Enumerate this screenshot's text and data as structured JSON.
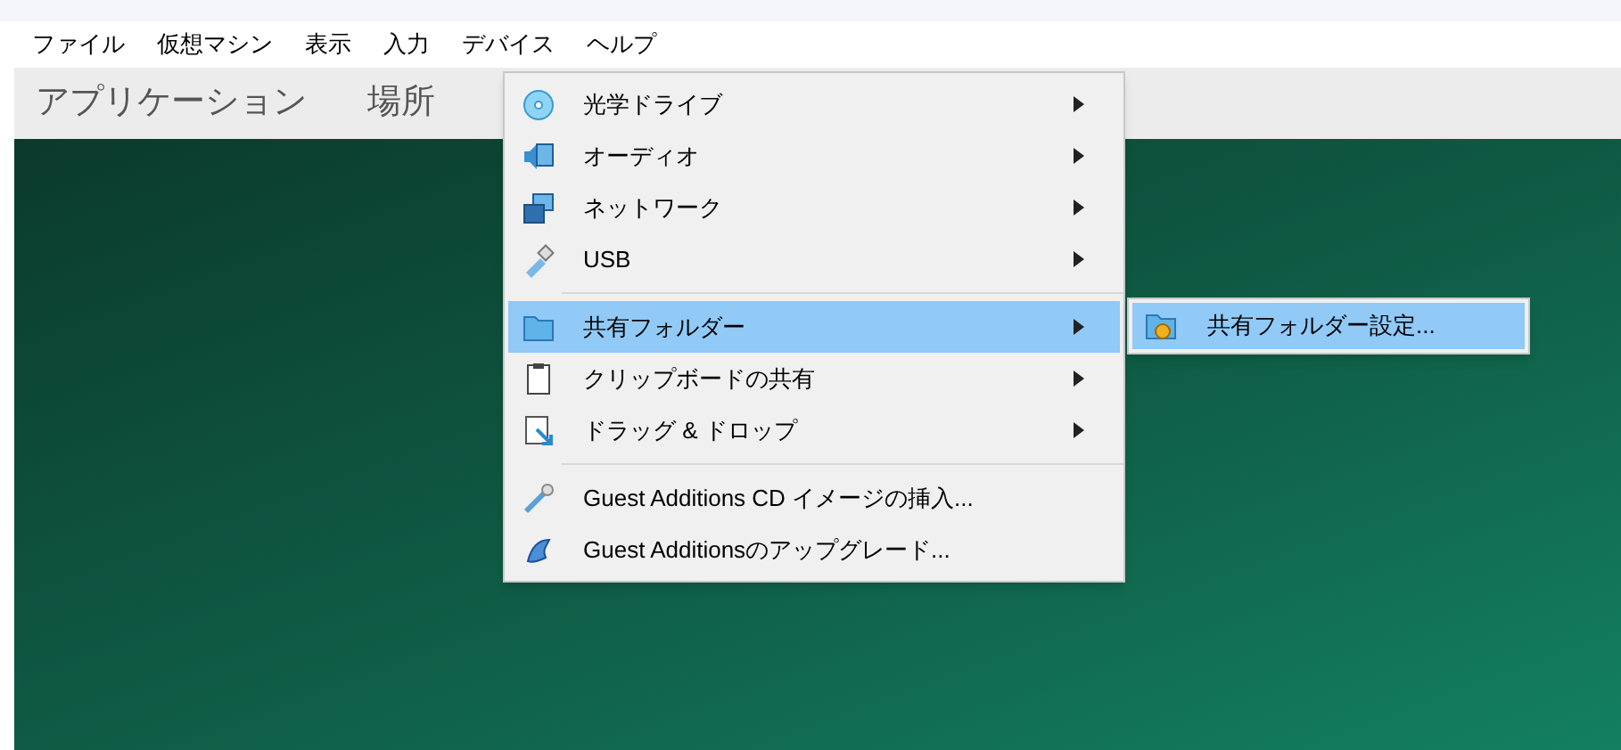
{
  "menubar": [
    {
      "label": "ファイル"
    },
    {
      "label": "仮想マシン"
    },
    {
      "label": "表示"
    },
    {
      "label": "入力"
    },
    {
      "label": "デバイス"
    },
    {
      "label": "ヘルプ"
    }
  ],
  "panel": [
    {
      "label": "アプリケーション"
    },
    {
      "label": "場所"
    }
  ],
  "menu": [
    {
      "kind": "item",
      "label": "光学ドライブ",
      "submenu": true,
      "selected": false
    },
    {
      "kind": "item",
      "label": "オーディオ",
      "submenu": true,
      "selected": false
    },
    {
      "kind": "item",
      "label": "ネットワーク",
      "submenu": true,
      "selected": false
    },
    {
      "kind": "item",
      "label": "USB",
      "submenu": true,
      "selected": false
    },
    {
      "kind": "separator"
    },
    {
      "kind": "item",
      "label": "共有フォルダー",
      "submenu": true,
      "selected": true
    },
    {
      "kind": "item",
      "label": "クリップボードの共有",
      "submenu": true,
      "selected": false
    },
    {
      "kind": "item",
      "label": "ドラッグ & ドロップ",
      "submenu": true,
      "selected": false
    },
    {
      "kind": "separator"
    },
    {
      "kind": "item",
      "label": "Guest Additions CD イメージの挿入...",
      "submenu": false,
      "selected": false
    },
    {
      "kind": "item",
      "label": "Guest Additionsのアップグレード...",
      "submenu": false,
      "selected": false
    }
  ],
  "submenu": [
    {
      "label": "共有フォルダー設定...",
      "selected": true
    }
  ]
}
